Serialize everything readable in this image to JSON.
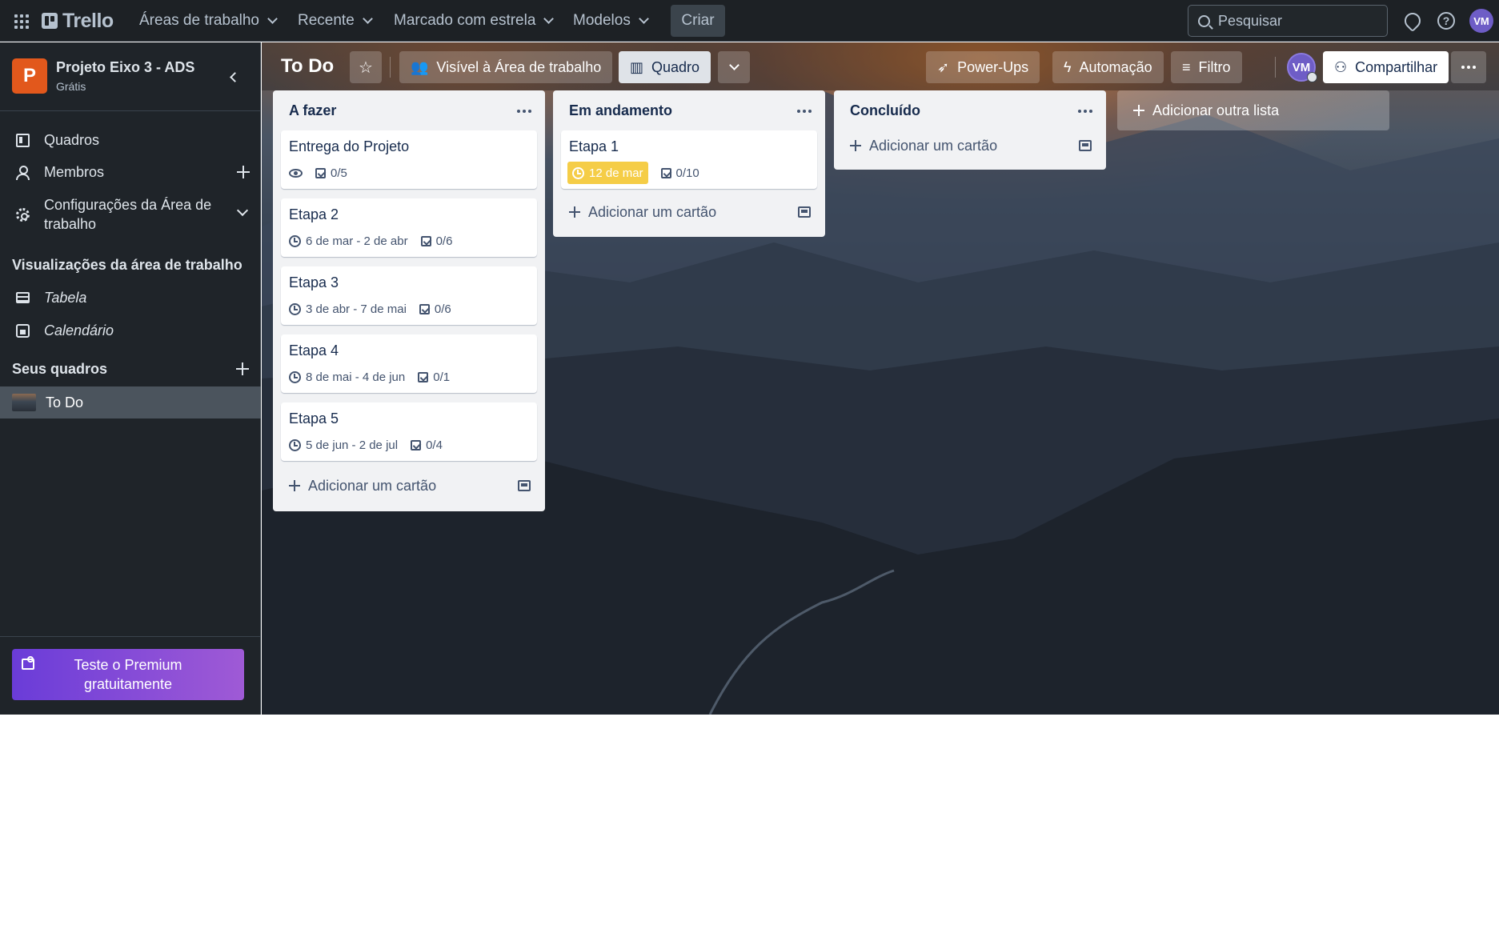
{
  "topbar": {
    "logo_text": "Trello",
    "menus": [
      "Áreas de trabalho",
      "Recente",
      "Marcado com estrela",
      "Modelos"
    ],
    "create_label": "Criar",
    "search_placeholder": "Pesquisar",
    "avatar_initials": "VM"
  },
  "sidebar": {
    "workspace_initial": "P",
    "workspace_name": "Projeto Eixo 3 - ADS",
    "workspace_plan": "Grátis",
    "items": [
      {
        "label": "Quadros",
        "icon": "board-icon"
      },
      {
        "label": "Membros",
        "icon": "members-icon"
      },
      {
        "label": "Configurações da Área de trabalho",
        "icon": "settings-icon"
      }
    ],
    "views_heading": "Visualizações da área de trabalho",
    "views": [
      {
        "label": "Tabela",
        "icon": "table-icon"
      },
      {
        "label": "Calendário",
        "icon": "calendar-icon"
      }
    ],
    "boards_heading": "Seus quadros",
    "boards": [
      "To Do"
    ],
    "premium_label": "Teste o Premium gratuitamente"
  },
  "board": {
    "title": "To Do",
    "visibility_label": "Visível à Área de trabalho",
    "view_label": "Quadro",
    "powerups_label": "Power-Ups",
    "automation_label": "Automação",
    "filter_label": "Filtro",
    "member_initials": "VM",
    "share_label": "Compartilhar",
    "add_list_label": "Adicionar outra lista",
    "add_card_label": "Adicionar um cartão",
    "lists": [
      {
        "title": "A fazer",
        "cards": [
          {
            "title": "Entrega do Projeto",
            "watch": true,
            "dates": "",
            "checklist": "0/5"
          },
          {
            "title": "Etapa 2",
            "dates": "6 de mar - 2 de abr",
            "checklist": "0/6"
          },
          {
            "title": "Etapa 3",
            "dates": "3 de abr - 7 de mai",
            "checklist": "0/6"
          },
          {
            "title": "Etapa 4",
            "dates": "8 de mai - 4 de jun",
            "checklist": "0/1"
          },
          {
            "title": "Etapa 5",
            "dates": "5 de jun - 2 de jul",
            "checklist": "0/4"
          }
        ]
      },
      {
        "title": "Em andamento",
        "cards": [
          {
            "title": "Etapa 1",
            "due": "12 de mar",
            "due_color": "#f5cd47",
            "checklist": "0/10"
          }
        ]
      },
      {
        "title": "Concluído",
        "cards": []
      }
    ]
  },
  "colors": {
    "topbar_bg": "#1d2125",
    "sidebar_bg": "#1f2429",
    "workspace_badge": "#e2581c",
    "avatar": "#6e5dc6",
    "premium_gradient": [
      "#6a3cd8",
      "#9f5ad6"
    ],
    "list_bg": "#f1f2f4"
  }
}
